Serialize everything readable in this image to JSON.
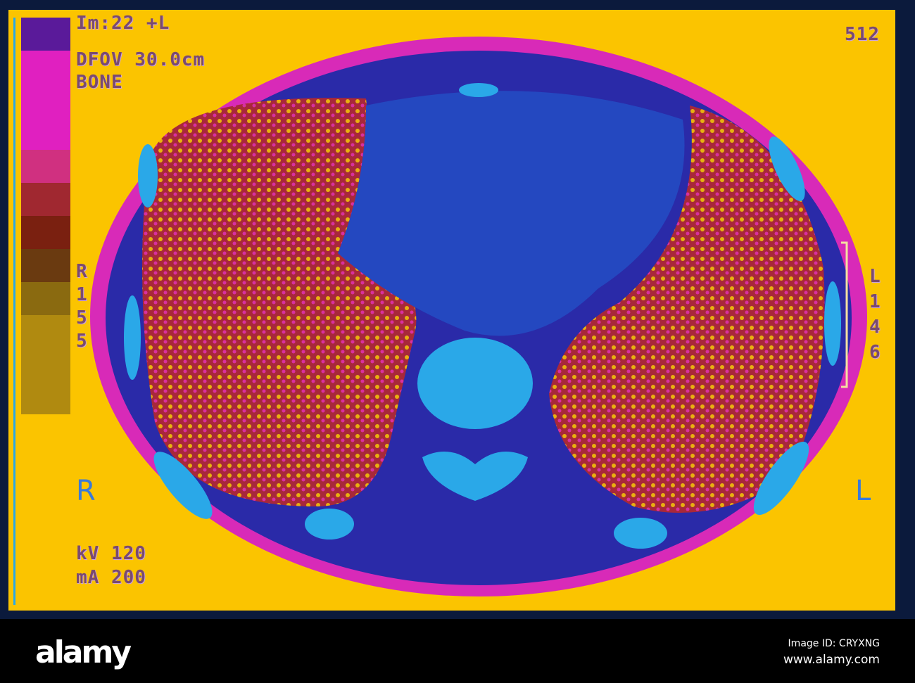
{
  "scan": {
    "top_left_line": "Im:22 +L",
    "dfov": "DFOV 30.0cm",
    "algorithm": "BONE",
    "matrix": "512",
    "right_measure": "R\n1\n5\n5",
    "left_measure": "L\n1\n4\n6",
    "right_marker": "R",
    "left_marker": "L",
    "kv": "kV 120",
    "ma": "mA 200",
    "colors": [
      "#5a1a9a",
      "#e020c0",
      "#d03080",
      "#a02830",
      "#7a2010",
      "#6a3a10",
      "#8a6a10",
      "#b08a10"
    ]
  },
  "footer": {
    "logo": "alamy",
    "image_id": "Image ID: CRYXNG",
    "site": "www.alamy.com"
  }
}
